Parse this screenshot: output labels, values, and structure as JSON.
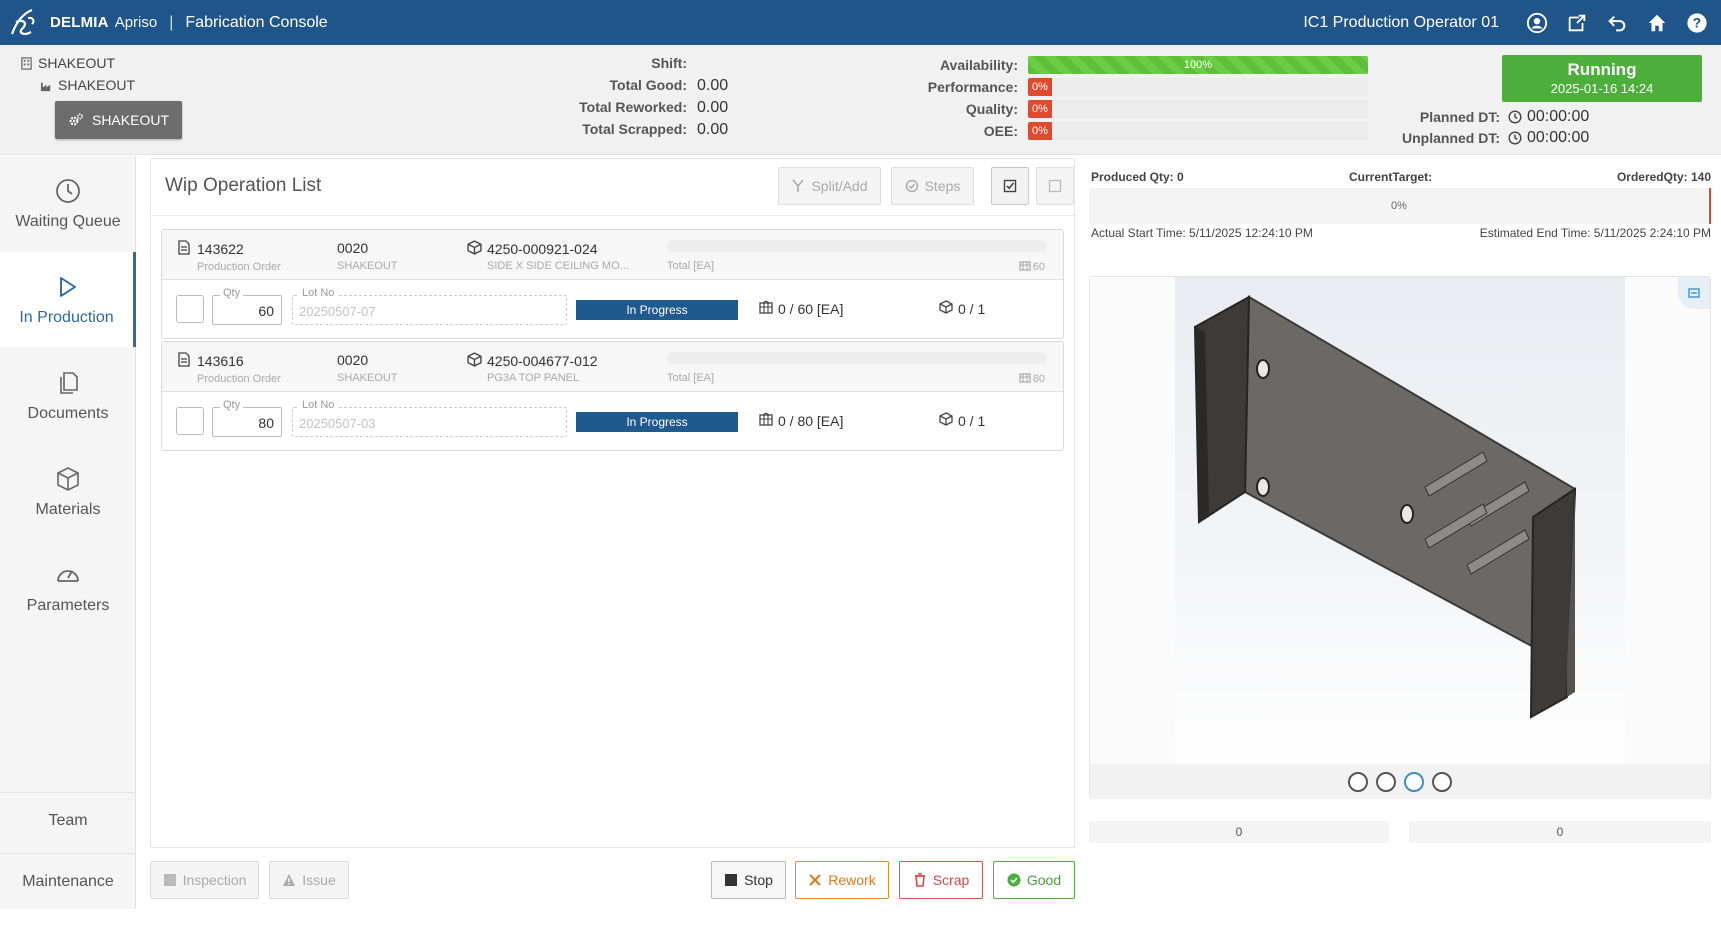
{
  "header": {
    "brand": "DELMIA",
    "app": "Apriso",
    "separator": "|",
    "console": "Fabrication Console",
    "user": "IC1 Production Operator 01",
    "icons": [
      "user-circle-icon",
      "export-icon",
      "back-icon",
      "home-icon",
      "help-icon"
    ]
  },
  "location": {
    "line1": "SHAKEOUT",
    "line2": "SHAKEOUT",
    "button": "SHAKEOUT"
  },
  "stats": [
    {
      "label": "Shift:",
      "value": ""
    },
    {
      "label": "Total Good:",
      "value": "0.00"
    },
    {
      "label": "Total Reworked:",
      "value": "0.00"
    },
    {
      "label": "Total Scrapped:",
      "value": "0.00"
    }
  ],
  "kpis": [
    {
      "label": "Availability:",
      "text": "100%",
      "percent": 100,
      "color": "#5fbf3a"
    },
    {
      "label": "Performance:",
      "text": "0%",
      "percent": 0,
      "color": "#e04a2e"
    },
    {
      "label": "Quality:",
      "text": "0%",
      "percent": 0,
      "color": "#e04a2e"
    },
    {
      "label": "OEE:",
      "text": "0%",
      "percent": 0,
      "color": "#e04a2e"
    }
  ],
  "status": {
    "title": "Running",
    "date": "2025-01-16 14:24",
    "color": "#4caf3a"
  },
  "downtime": {
    "planned_label": "Planned DT:",
    "planned_value": "00:00:00",
    "unplanned_label": "Unplanned DT:",
    "unplanned_value": "00:00:00"
  },
  "nav": {
    "waiting": "Waiting Queue",
    "production": "In Production",
    "documents": "Documents",
    "materials": "Materials",
    "parameters": "Parameters",
    "team": "Team",
    "maintenance": "Maintenance"
  },
  "wip": {
    "title": "Wip Operation List",
    "split_label": "Split/Add",
    "steps_label": "Steps"
  },
  "orders": [
    {
      "order": "143622",
      "order_sub": "Production Order",
      "op": "0020",
      "op_sub": "SHAKEOUT",
      "part": "4250-000921-024",
      "part_sub": "SIDE X SIDE CEILING MO...",
      "total_label": "Total [EA]",
      "total_qty": "60",
      "qty_label": "Qty",
      "qty": "60",
      "lot_label": "Lot No",
      "lot": "20250507-07",
      "status": "In Progress",
      "count": "0 / 60 [EA]",
      "steps": "0 / 1"
    },
    {
      "order": "143616",
      "order_sub": "Production Order",
      "op": "0020",
      "op_sub": "SHAKEOUT",
      "part": "4250-004677-012",
      "part_sub": "PG3A TOP PANEL",
      "total_label": "Total [EA]",
      "total_qty": "80",
      "qty_label": "Qty",
      "qty": "80",
      "lot_label": "Lot No",
      "lot": "20250507-03",
      "status": "In Progress",
      "count": "0 / 80 [EA]",
      "steps": "0 / 1"
    }
  ],
  "footer": {
    "inspection": "Inspection",
    "issue": "Issue",
    "stop": "Stop",
    "rework": "Rework",
    "scrap": "Scrap",
    "good": "Good"
  },
  "production": {
    "produced": "Produced Qty: 0",
    "target": "CurrentTarget:",
    "ordered": "OrderedQty: 140",
    "progress_text": "0%",
    "start": "Actual Start Time: 5/11/2025 12:24:10 PM",
    "end": "Estimated End Time: 5/11/2025 2:24:10 PM",
    "foot_left": "0",
    "foot_right": "0"
  },
  "viewer": {
    "dots": 4,
    "active_dot": 3
  }
}
